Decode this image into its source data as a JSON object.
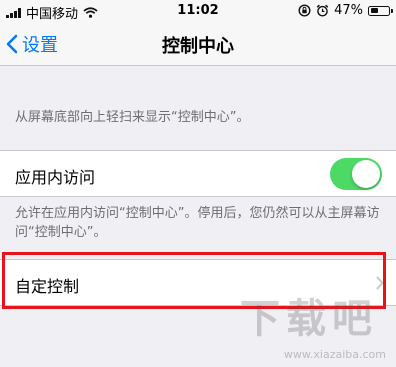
{
  "status_bar": {
    "carrier": "中国移动",
    "time": "11:02",
    "battery_percent": "47%",
    "battery_level": 0.47,
    "icons": [
      "signal-icon",
      "wifi-icon",
      "rotation-lock-icon",
      "alarm-icon",
      "battery-icon"
    ]
  },
  "nav": {
    "back_label": "设置",
    "title": "控制中心"
  },
  "section_hint": "从屏幕底部向上轻扫来显示“控制中心”。",
  "access_within_apps": {
    "label": "应用内访问",
    "enabled": true,
    "footer": "允许在应用内访问“控制中心”。停用后，您仍然可以从主屏幕访问“控制中心”。"
  },
  "customize": {
    "label": "自定控制"
  },
  "highlight_color": "#e8141b",
  "toggle_color": "#4cd964",
  "accent_color": "#007aff",
  "watermark": {
    "logo": "下载吧",
    "site": "www.xiazaiba.com"
  }
}
